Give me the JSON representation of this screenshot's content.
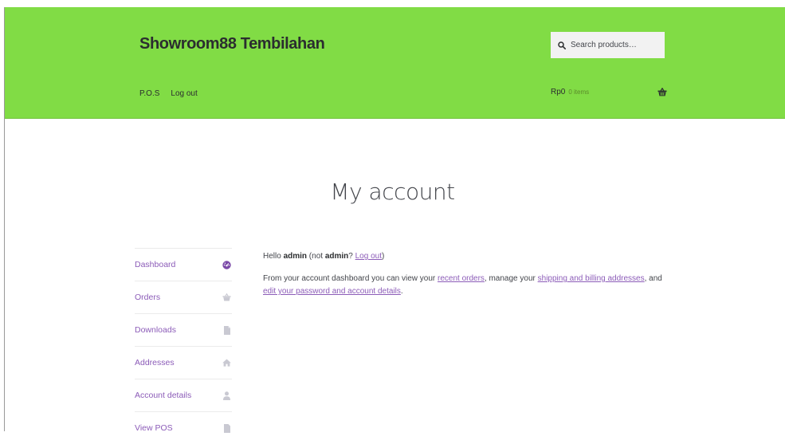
{
  "header": {
    "site_title": "Showroom88 Tembilahan",
    "search_placeholder": "Search products…",
    "nav": [
      "P.O.S",
      "Log out"
    ],
    "cart_amount": "Rp0",
    "cart_count": "0 items"
  },
  "page_title": "My account",
  "account_nav": [
    {
      "label": "Dashboard",
      "icon": "dashboard-icon"
    },
    {
      "label": "Orders",
      "icon": "basket-icon"
    },
    {
      "label": "Downloads",
      "icon": "file-icon"
    },
    {
      "label": "Addresses",
      "icon": "home-icon"
    },
    {
      "label": "Account details",
      "icon": "user-icon"
    },
    {
      "label": "View POS",
      "icon": "file-icon"
    }
  ],
  "content": {
    "hello_prefix": "Hello ",
    "username": "admin",
    "not_prefix": " (not ",
    "not_user": "admin",
    "not_suffix": "? ",
    "logout_link": "Log out",
    "close_paren": ")",
    "dash_prefix": "From your account dashboard you can view your ",
    "recent_orders_link": "recent orders",
    "dash_mid": ", manage your ",
    "addresses_link": "shipping and billing addresses",
    "dash_and": ", and ",
    "edit_link": "edit your password and account details",
    "dash_end": "."
  },
  "colors": {
    "header_bg": "#81dc45",
    "link": "#8c5cb8",
    "active_icon": "#7b4aa8",
    "inactive_icon": "#c9c9d2"
  }
}
